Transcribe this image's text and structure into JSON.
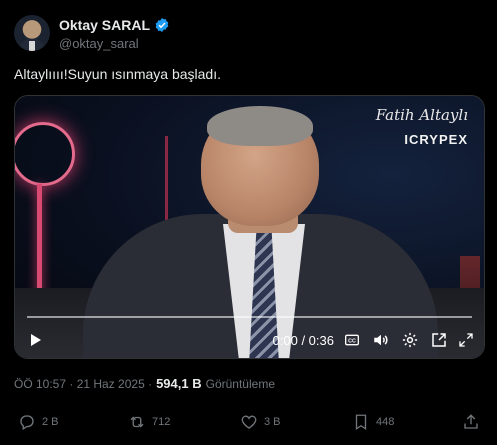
{
  "author": {
    "name": "Oktay SARAL",
    "handle": "@oktay_saral",
    "verified_color": "#1d9bf0"
  },
  "tweet": {
    "text": "Altaylıııı!Suyun ısınmaya başladı."
  },
  "video": {
    "watermark_name": "Fatih Altaylı",
    "watermark_brand": "ICRYPEX",
    "time": "0:00 / 0:36",
    "progress": 0
  },
  "meta": {
    "timestamp": "ÖÖ 10:57 · 21 Haz 2025 ·",
    "views": "594,1 B",
    "views_label": "Görüntüleme"
  },
  "actions": {
    "replies": "2 B",
    "reposts": "712",
    "likes": "3 B",
    "bookmarks": "448"
  },
  "icons": [
    "verified-badge-icon",
    "play-icon",
    "captions-icon",
    "volume-icon",
    "settings-icon",
    "picture-in-picture-icon",
    "fullscreen-icon",
    "reply-icon",
    "repost-icon",
    "like-icon",
    "bookmark-icon",
    "share-icon"
  ],
  "colors": {
    "background": "#000000",
    "text": "#e7e9ea",
    "muted": "#71767b",
    "accent": "#1d9bf0"
  }
}
